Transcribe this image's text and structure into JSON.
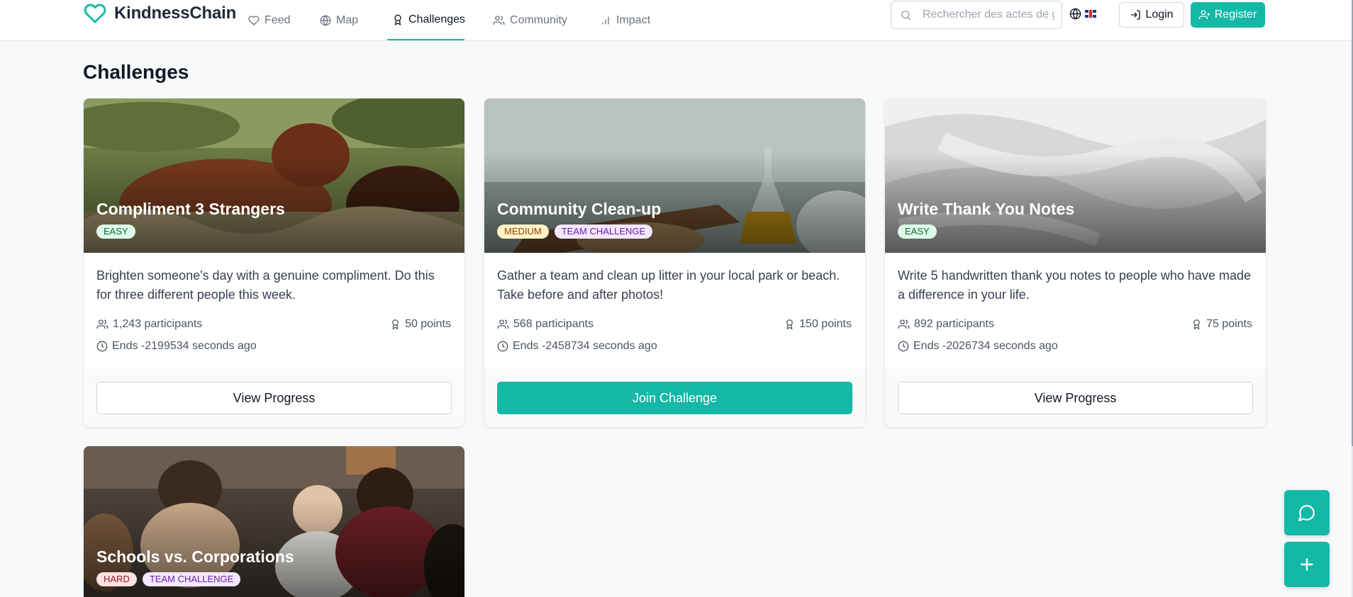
{
  "app": {
    "name": "KindnessChain"
  },
  "nav": [
    {
      "label": "Feed",
      "icon": "heart-icon"
    },
    {
      "label": "Map",
      "icon": "globe-icon"
    },
    {
      "label": "Challenges",
      "icon": "award-icon",
      "active": true
    },
    {
      "label": "Community",
      "icon": "users-icon"
    },
    {
      "label": "Impact",
      "icon": "bar-chart-icon"
    }
  ],
  "search": {
    "placeholder": "Rechercher des actes de g",
    "value": ""
  },
  "language": {
    "icon": "globe-icon",
    "flag": "uk-flag-icon"
  },
  "auth": {
    "login_label": "Login",
    "register_label": "Register"
  },
  "page": {
    "title": "Challenges"
  },
  "challenges": [
    {
      "title": "Compliment 3 Strangers",
      "badges": [
        "EASY"
      ],
      "description": "Brighten someone's day with a genuine compliment. Do this for three different people this week.",
      "participants": "1,243 participants",
      "points": "50 points",
      "ends": "Ends -2199534 seconds ago",
      "action": "View Progress"
    },
    {
      "title": "Community Clean-up",
      "badges": [
        "MEDIUM",
        "TEAM CHALLENGE"
      ],
      "description": "Gather a team and clean up litter in your local park or beach. Take before and after photos!",
      "participants": "568 participants",
      "points": "150 points",
      "ends": "Ends -2458734 seconds ago",
      "action": "Join Challenge"
    },
    {
      "title": "Write Thank You Notes",
      "badges": [
        "EASY"
      ],
      "description": "Write 5 handwritten thank you notes to people who have made a difference in your life.",
      "participants": "892 participants",
      "points": "75 points",
      "ends": "Ends -2026734 seconds ago",
      "action": "View Progress"
    },
    {
      "title": "Schools vs. Corporations",
      "badges": [
        "HARD",
        "TEAM CHALLENGE"
      ]
    }
  ],
  "fabs": [
    {
      "icon": "chat-bubble-icon"
    },
    {
      "icon": "plus-icon"
    }
  ],
  "colors": {
    "accent": "#14b8a6",
    "background": "#f8f9fa",
    "text": "#111827"
  }
}
